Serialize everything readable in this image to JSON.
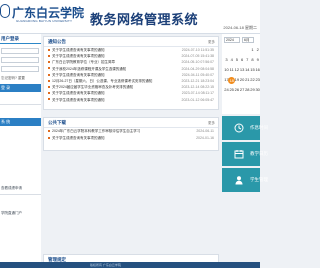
{
  "header": {
    "logo_cn": "广东白云学院",
    "logo_en": "GUANGDONG BAIYUN UNIVERSITY",
    "title": "教务网络管理系统",
    "date": "2024-06-18 星期二"
  },
  "left": {
    "login_title": "用户登录",
    "note": "忘记密码? 重置",
    "login_button": "登 录",
    "section_title": "系 统",
    "links": [
      "查看成绩申请",
      "学院直通门户"
    ]
  },
  "notice": {
    "title": "通知公告",
    "more": "更多",
    "items": [
      {
        "text": "关于学生成绩查询有关事项的通知",
        "date": "2024-07-10 11:51:35"
      },
      {
        "text": "关于学生成绩查询有关事项的通知",
        "date": "2024-07-05 15:41:38"
      },
      {
        "text": "广东白云学院教育学位（专业）招生简章",
        "date": "2024-05-10 07:56:07"
      },
      {
        "text": "关于我校2024年选修课程开课及学生选课的通知",
        "date": "2024-04-29 08:04:58"
      },
      {
        "text": "关于学生成绩查询有关事项的通知",
        "date": "2024-04-11 05:40:07"
      },
      {
        "text": "12月26-27日（星期六、日）公选课、专业选修课考试安排的通知",
        "date": "2023-12-21 18:23:04"
      },
      {
        "text": "关于2024届应届学生毕业资格审查及补考安排的通知",
        "date": "2023-12-14 08:22:15"
      },
      {
        "text": "关于学生成绩查询有关事项的通知",
        "date": "2023-07-14 08:11:17"
      },
      {
        "text": "关于学生成绩查询有关事项的通知",
        "date": "2023-01-12 06:05:47"
      }
    ]
  },
  "public": {
    "title": "公共下载",
    "more": "更多",
    "items": [
      {
        "text": "2024年广东白云学院本科教学工作审核评估学生自主学习",
        "date": "2024-06-11"
      },
      {
        "text": "关于学生成绩查询有关事项的通知",
        "date": "2024-01-16"
      }
    ]
  },
  "bottom": {
    "title": "管理规定"
  },
  "calendar": {
    "year": "2024",
    "month": "6月",
    "rows": [
      [
        "",
        "",
        "",
        "",
        "",
        "1",
        "2"
      ],
      [
        "3",
        "4",
        "5",
        "6",
        "7",
        "8",
        "9"
      ],
      [
        "10",
        "11",
        "12",
        "13",
        "14",
        "15",
        "16"
      ],
      [
        "17",
        "18",
        "19",
        "20",
        "21",
        "22",
        "23"
      ],
      [
        "24",
        "25",
        "26",
        "27",
        "28",
        "29",
        "30"
      ]
    ],
    "today": "18"
  },
  "tiles": [
    {
      "label": "作息时间",
      "icon": "clock-icon",
      "color": "#2a98a9"
    },
    {
      "label": "教学日历",
      "icon": "calendar-icon",
      "color": "#2a98a9"
    },
    {
      "label": "学生管理",
      "icon": "user-icon",
      "color": "#2a98a9"
    }
  ],
  "footer": {
    "text": "版权所有 广东白云学院"
  }
}
